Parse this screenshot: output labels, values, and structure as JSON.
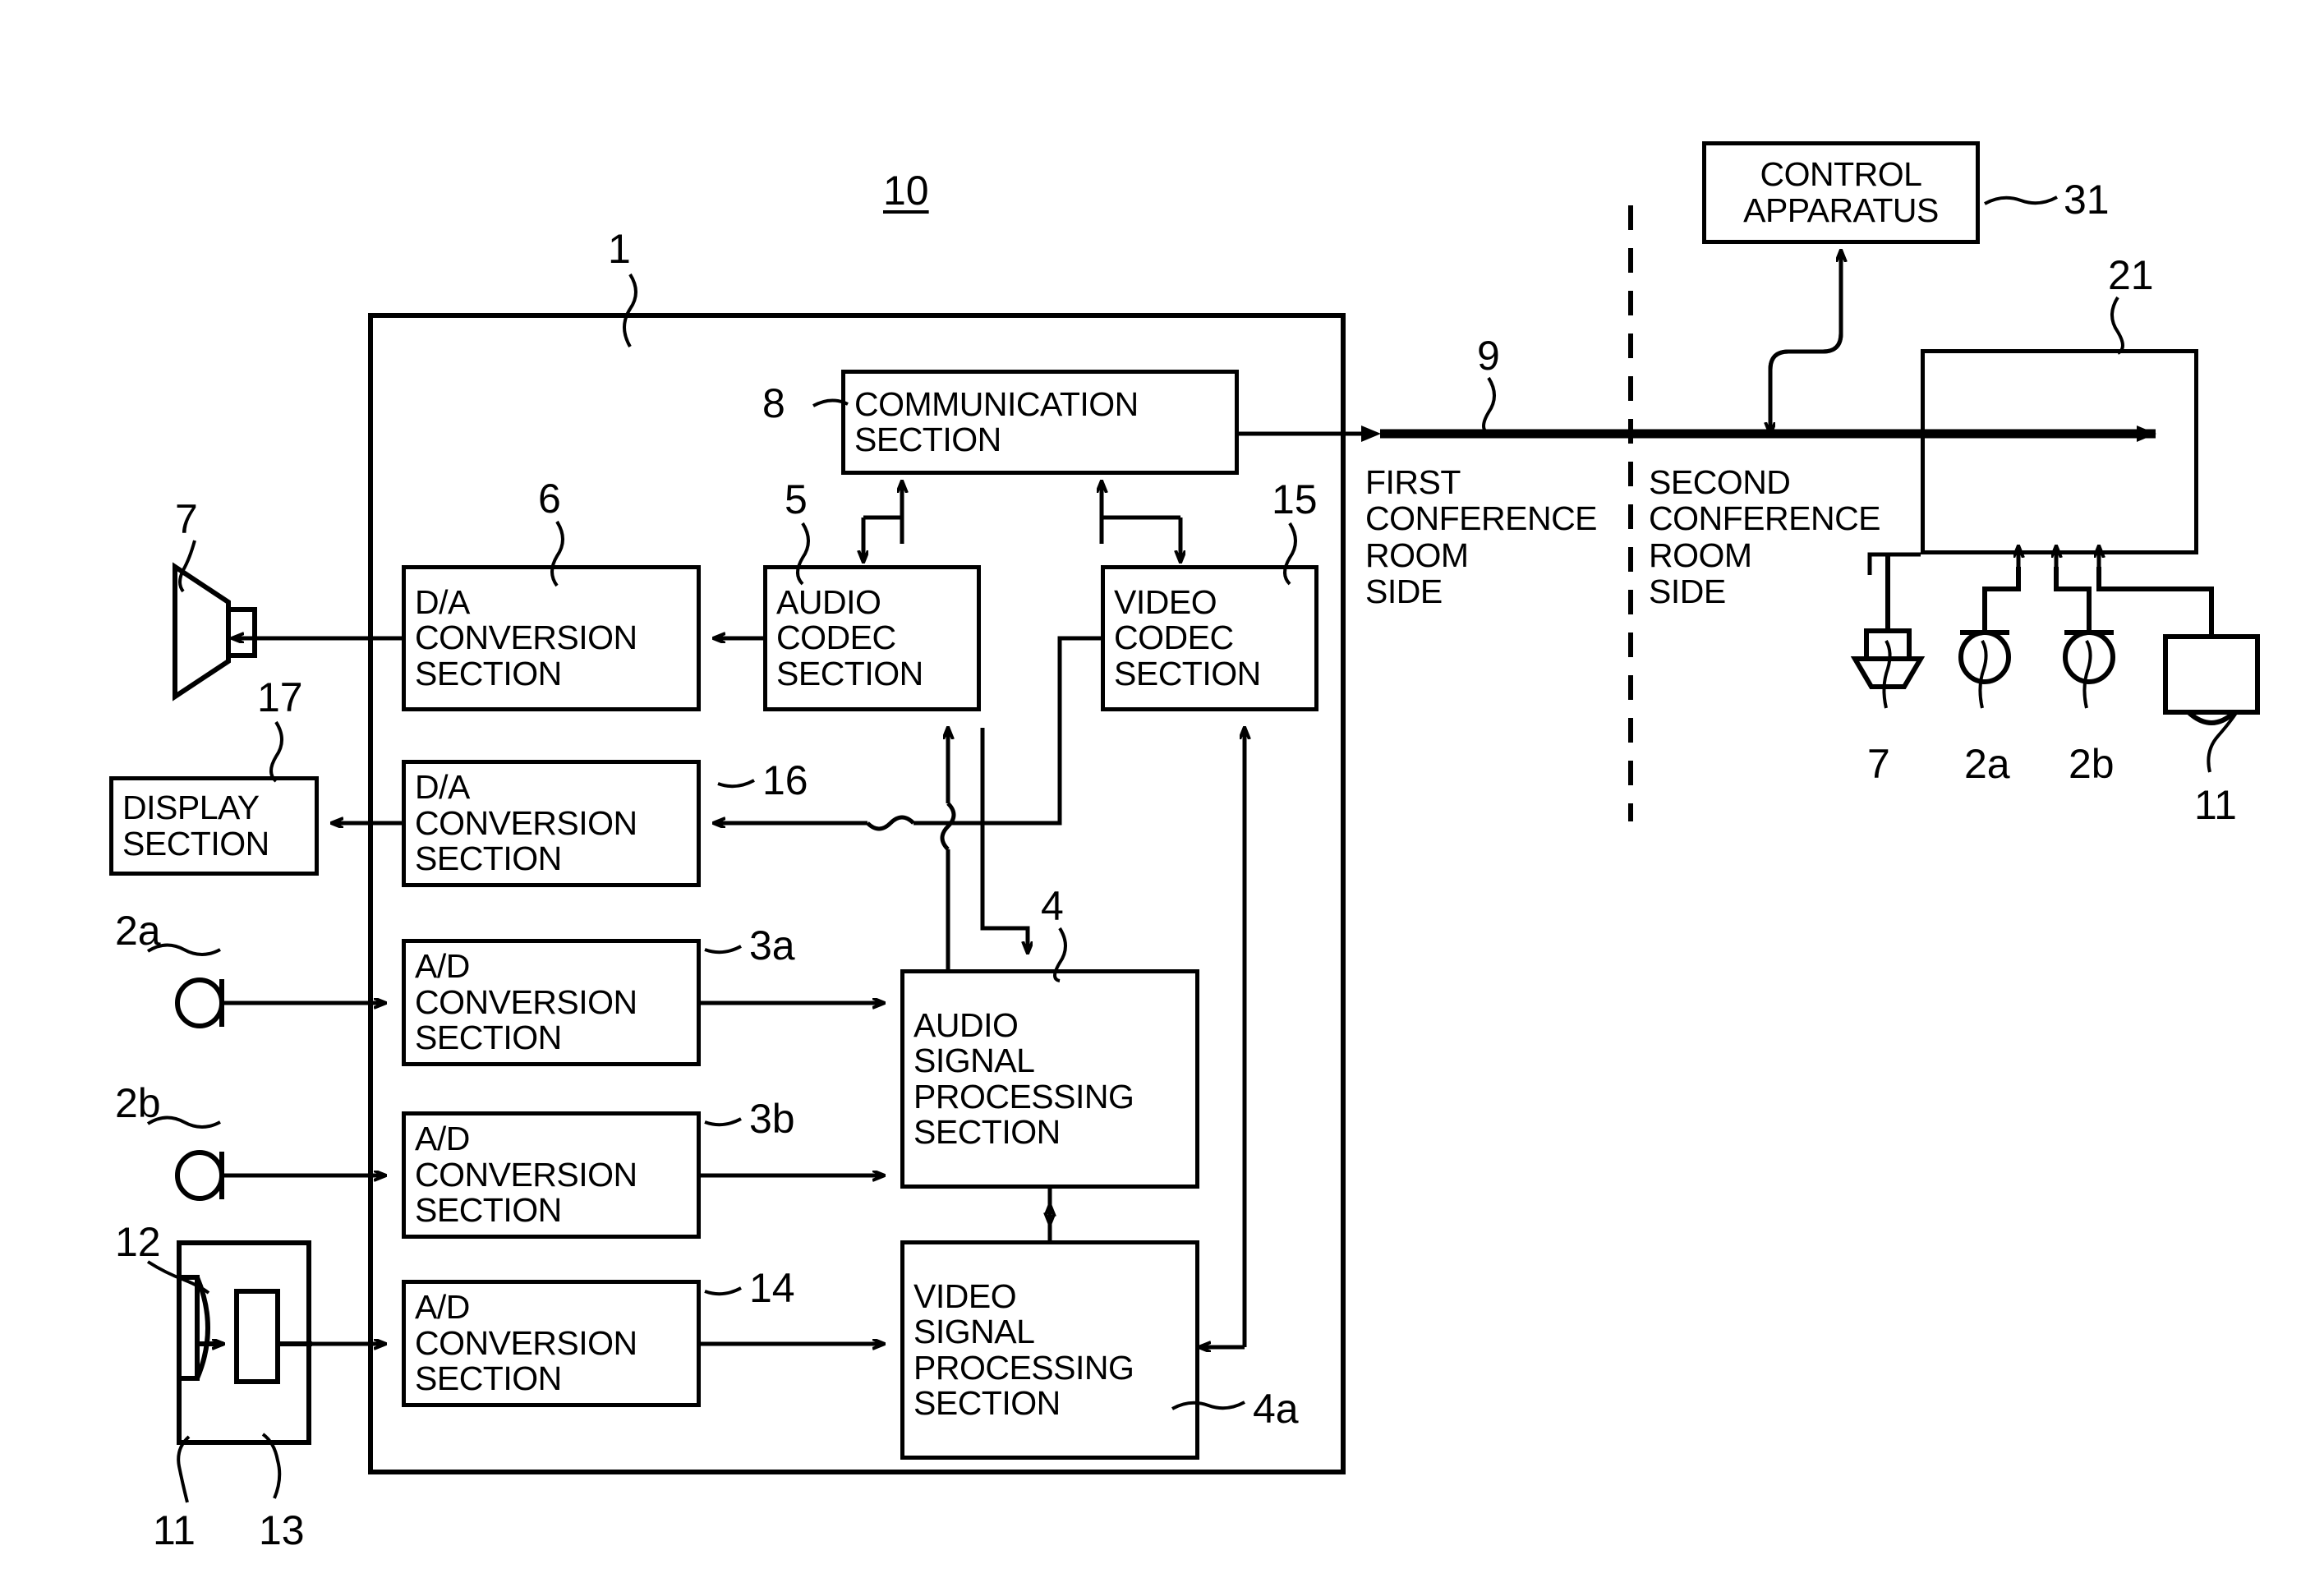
{
  "figure": {
    "system_ref": "10",
    "terminal_ref": "1"
  },
  "blocks": {
    "communication": {
      "label": "COMMUNICATION\nSECTION",
      "ref": "8"
    },
    "da_audio": {
      "label": "D/A\nCONVERSION\nSECTION",
      "ref": "6"
    },
    "audio_codec": {
      "label": "AUDIO\nCODEC\nSECTION",
      "ref": "5"
    },
    "video_codec": {
      "label": "VIDEO\nCODEC\nSECTION",
      "ref": "15"
    },
    "da_video": {
      "label": "D/A\nCONVERSION\nSECTION",
      "ref": "16"
    },
    "display": {
      "label": "DISPLAY\nSECTION",
      "ref": "17"
    },
    "ad_mic_a": {
      "label": "A/D\nCONVERSION\nSECTION",
      "ref": "3a"
    },
    "ad_mic_b": {
      "label": "A/D\nCONVERSION\nSECTION",
      "ref": "3b"
    },
    "ad_camera": {
      "label": "A/D\nCONVERSION\nSECTION",
      "ref": "14"
    },
    "audio_sigproc": {
      "label": "AUDIO\nSIGNAL\nPROCESSING\nSECTION",
      "ref": "4"
    },
    "video_sigproc": {
      "label": "VIDEO\nSIGNAL\nPROCESSING\nSECTION",
      "ref": "4a"
    },
    "control_apparatus": {
      "label": "CONTROL\nAPPARATUS",
      "ref": "31"
    },
    "remote_terminal": {
      "label": "",
      "ref": "21"
    }
  },
  "devices": {
    "speaker_left": {
      "ref": "7",
      "icon": "speaker-icon"
    },
    "mic_a_left": {
      "ref": "2a",
      "icon": "microphone-icon"
    },
    "mic_b_left": {
      "ref": "2b",
      "icon": "microphone-icon"
    },
    "camera_left": {
      "ref": "11",
      "icon": "camera-icon"
    },
    "lens_left": {
      "ref": "12",
      "icon": "lens-icon"
    },
    "sensor_left": {
      "ref": "13",
      "icon": "image-sensor-icon"
    },
    "speaker_right": {
      "ref": "7",
      "icon": "speaker-icon"
    },
    "mic_a_right": {
      "ref": "2a",
      "icon": "microphone-icon"
    },
    "mic_b_right": {
      "ref": "2b",
      "icon": "microphone-icon"
    },
    "camera_right": {
      "ref": "11",
      "icon": "camera-icon"
    }
  },
  "network": {
    "link_ref": "9",
    "first_room_label": "FIRST\nCONFERENCE\nROOM\nSIDE",
    "second_room_label": "SECOND\nCONFERENCE\nROOM\nSIDE"
  }
}
